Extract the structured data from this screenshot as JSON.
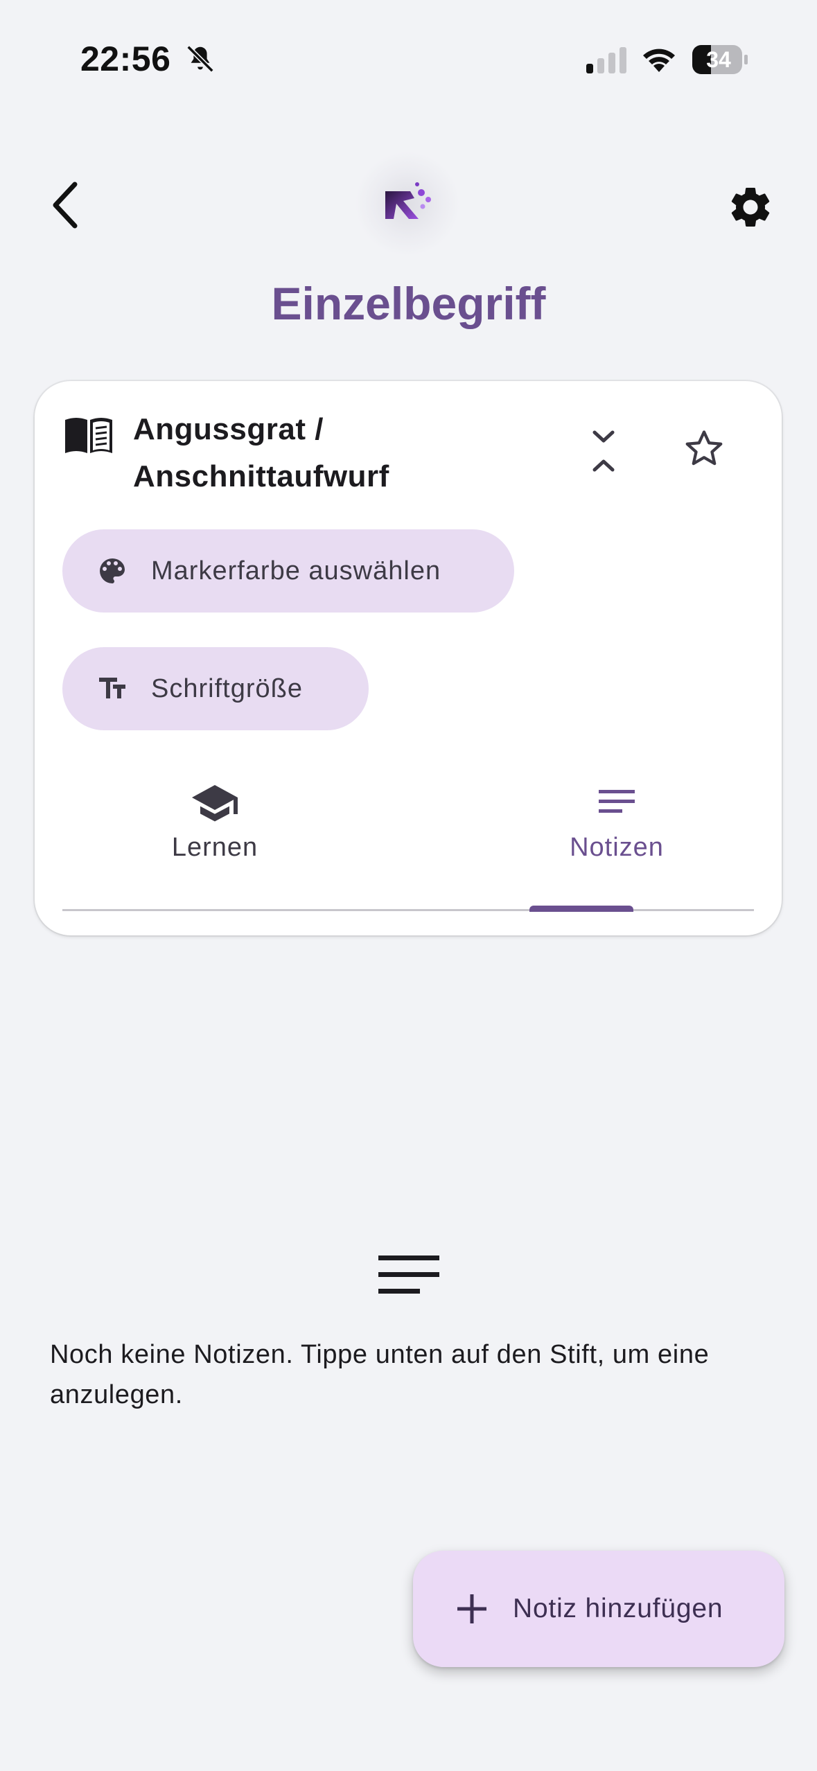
{
  "status_bar": {
    "time": "22:56",
    "battery": "34"
  },
  "header": {
    "title": "Einzelbegriff"
  },
  "card": {
    "term": "Angussgrat / Anschnittaufwurf",
    "chips": {
      "marker_color": "Markerfarbe auswählen",
      "font_size": "Schriftgröße"
    },
    "tabs": [
      {
        "label": "Lernen",
        "icon": "school-icon",
        "selected": false
      },
      {
        "label": "Notizen",
        "icon": "notes-icon",
        "selected": true
      }
    ]
  },
  "notes": {
    "empty_message": "Noch keine Notizen. Tippe unten auf den Stift, um eine anzulegen."
  },
  "fab": {
    "label": "Notiz hinzufügen"
  },
  "colors": {
    "accent": "#6a4f8f",
    "chip_bg": "#e8dcf2",
    "fab_bg": "#ebdaf6",
    "background": "#f2f3f6"
  }
}
